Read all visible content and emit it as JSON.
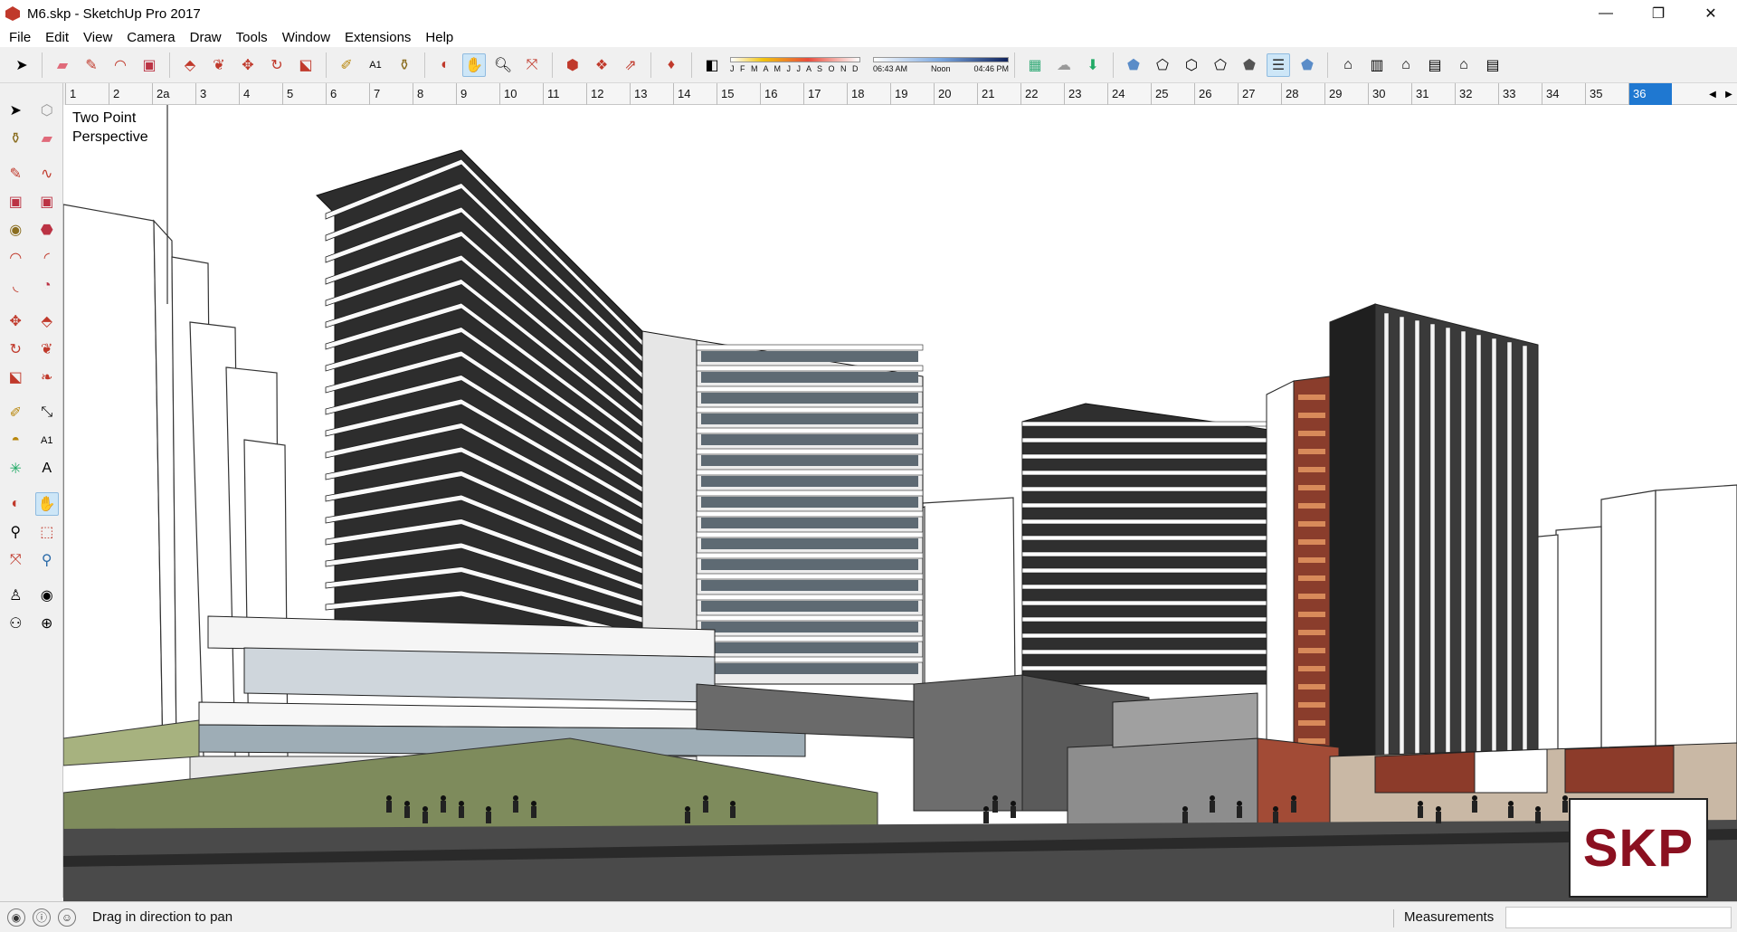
{
  "window": {
    "title": "M6.skp - SketchUp Pro 2017",
    "minimize_icon": "minimize-icon",
    "maximize_icon": "restore-icon",
    "close_icon": "close-icon"
  },
  "menu": [
    "File",
    "Edit",
    "View",
    "Camera",
    "Draw",
    "Tools",
    "Window",
    "Extensions",
    "Help"
  ],
  "shadow_settings": {
    "months": "J F M A M J J A S O N D",
    "time_start": "06:43 AM",
    "time_mid": "Noon",
    "time_end": "04:46 PM"
  },
  "scenes": {
    "tabs": [
      "1",
      "2",
      "2a",
      "3",
      "4",
      "5",
      "6",
      "7",
      "8",
      "9",
      "10",
      "11",
      "12",
      "13",
      "14",
      "15",
      "16",
      "17",
      "18",
      "19",
      "20",
      "21",
      "22",
      "23",
      "24",
      "25",
      "26",
      "27",
      "28",
      "29",
      "30",
      "31",
      "32",
      "33",
      "34",
      "35",
      "36"
    ],
    "active": "36",
    "nav_left": "◀",
    "nav_right": "▶"
  },
  "viewport": {
    "view_label_line1": "Two Point",
    "view_label_line2": "Perspective",
    "logo_text": "SKP"
  },
  "status": {
    "message": "Drag in direction to pan",
    "measurements_label": "Measurements",
    "measurements_value": ""
  },
  "colors": {
    "active_scene": "#1f78d1",
    "logo_text": "#8b1020",
    "app_icon": "#c0392b"
  }
}
